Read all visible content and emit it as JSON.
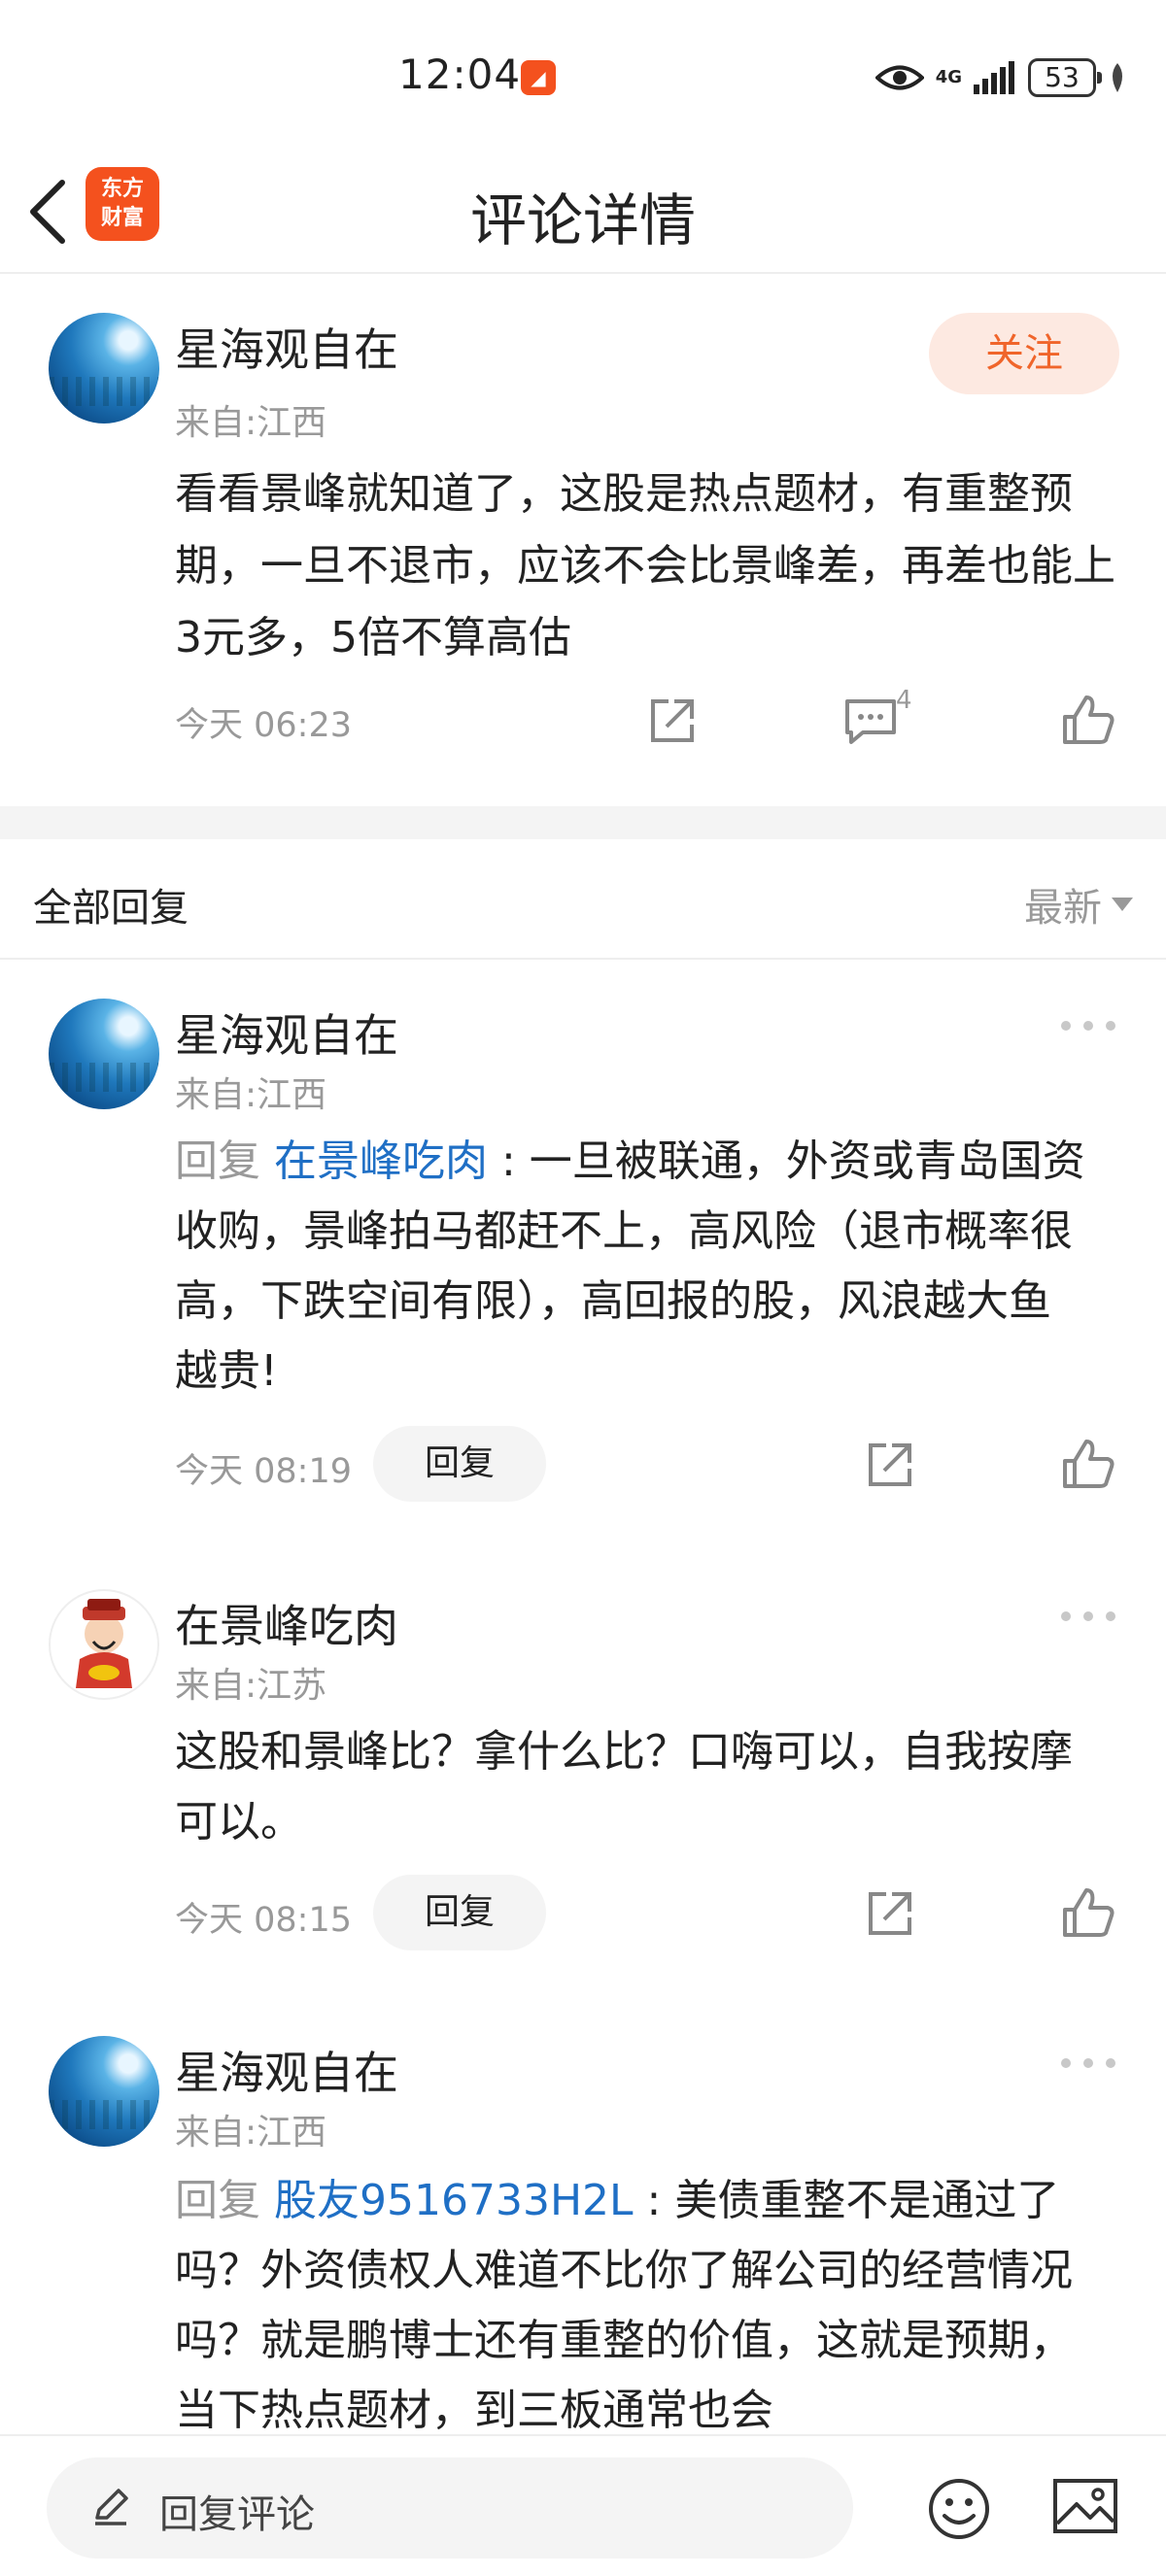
{
  "status_bar": {
    "time": "12:04",
    "network": "4G",
    "battery": "53"
  },
  "header": {
    "logo_line1": "东方",
    "logo_line2": "财富",
    "title": "评论详情"
  },
  "main_post": {
    "author": "星海观自在",
    "location": "来自:江西",
    "follow_label": "关注",
    "text": "看看景峰就知道了，这股是热点题材，有重整预期，一旦不退市，应该不会比景峰差，再差也能上3元多，5倍不算高估",
    "time": "今天 06:23",
    "reply_count": "4"
  },
  "replies_section": {
    "title": "全部回复",
    "sort_label": "最新"
  },
  "replies": [
    {
      "author": "星海观自在",
      "location": "来自:江西",
      "reply_prefix": "回复 ",
      "mention": "在景峰吃肉",
      "text": " : 一旦被联通，外资或青岛国资收购，景峰拍马都赶不上，高风险（退市概率很高，下跌空间有限），高回报的股，风浪越大鱼越贵!",
      "time": "今天 08:19",
      "reply_label": "回复"
    },
    {
      "author": "在景峰吃肉",
      "location": "来自:江苏",
      "text": "这股和景峰比？拿什么比？口嗨可以，自我按摩可以。",
      "time": "今天 08:15",
      "reply_label": "回复"
    },
    {
      "author": "星海观自在",
      "location": "来自:江西",
      "reply_prefix": "回复 ",
      "mention": "股友9516733H2L",
      "text": " : 美债重整不是通过了吗？外资债权人难道不比你了解公司的经营情况吗？就是鹏博士还有重整的价值，这就是预期，当下热点题材，到三板通常也会"
    }
  ],
  "bottom_bar": {
    "placeholder": "回复评论"
  }
}
